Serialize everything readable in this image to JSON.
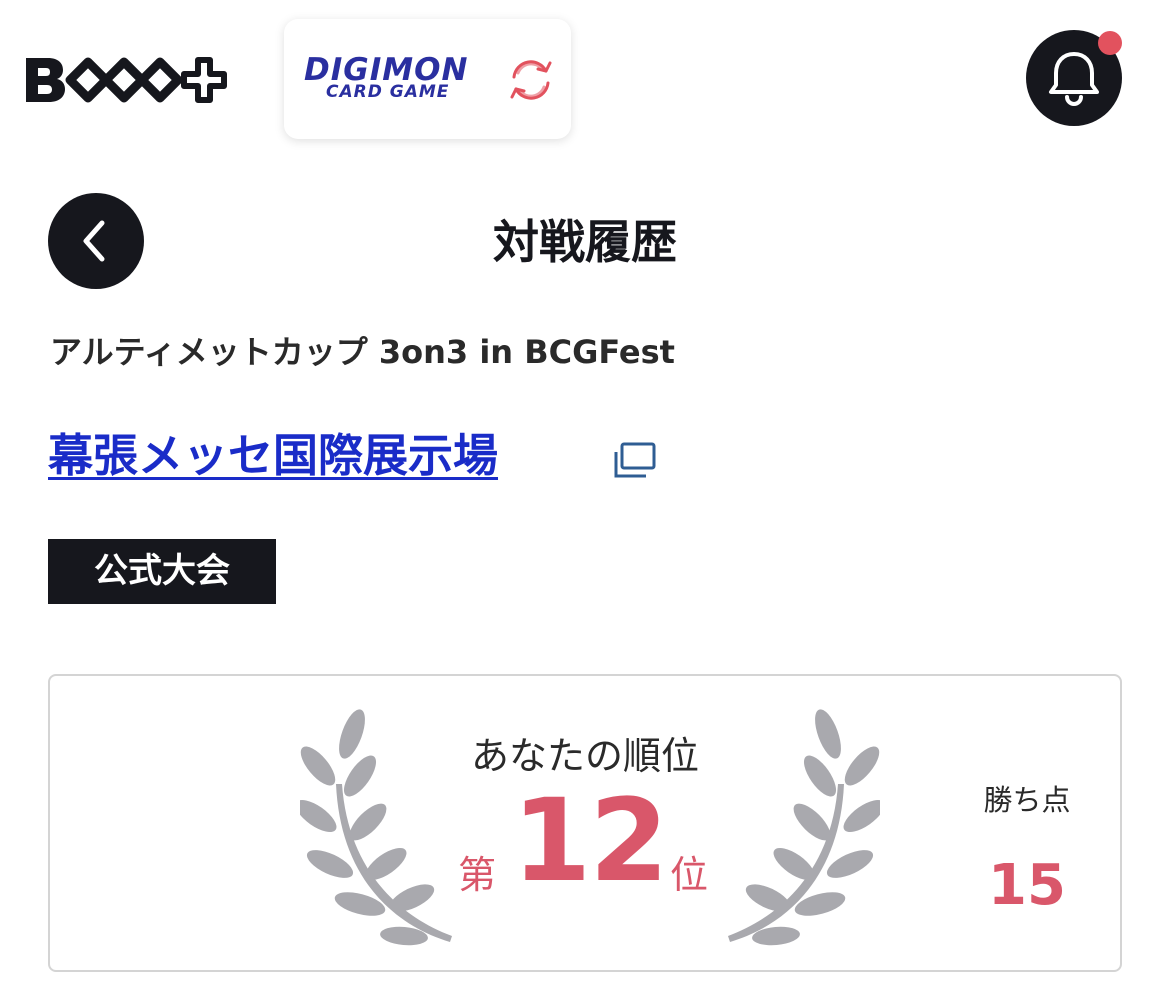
{
  "header": {
    "app_logo_text": "BCG+",
    "game_logo": {
      "line1": "DIGIMON",
      "line2": "CARD GAME"
    },
    "icons": {
      "switch": "refresh-icon",
      "notification": "bell-icon"
    },
    "has_unread_notification": true
  },
  "page": {
    "title": "対戦履歴",
    "back_icon": "chevron-left-icon"
  },
  "event": {
    "name": "アルティメットカップ 3on3 in BCGFest",
    "venue": "幕張メッセ国際展示場",
    "venue_link_icon": "external-link-icon",
    "tag": "公式大会"
  },
  "result": {
    "rank_label": "あなたの順位",
    "rank_prefix": "第",
    "rank": "12",
    "rank_suffix": "位",
    "points_label": "勝ち点",
    "points": "15",
    "laurel_icon": "laurel-wreath-icon"
  },
  "colors": {
    "dark": "#16171d",
    "accent_red": "#d9576a",
    "link_blue": "#1a2cc8",
    "notification_dot": "#e2525e",
    "laurel_gray": "#a9a9ae"
  }
}
